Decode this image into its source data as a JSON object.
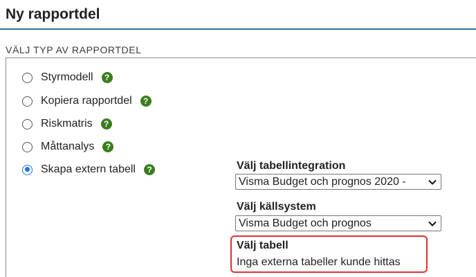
{
  "page": {
    "title": "Ny rapportdel",
    "section_label": "VÄLJ TYP AV RAPPORTDEL"
  },
  "options": [
    {
      "label": "Styrmodell",
      "selected": false,
      "help_icon": "question-circle-icon"
    },
    {
      "label": "Kopiera rapportdel",
      "selected": false,
      "help_icon": "question-circle-icon"
    },
    {
      "label": "Riskmatris",
      "selected": false,
      "help_icon": "question-circle-icon"
    },
    {
      "label": "Måttanalys",
      "selected": false,
      "help_icon": "question-circle-icon"
    },
    {
      "label": "Skapa extern tabell",
      "selected": true,
      "help_icon": "question-circle-icon"
    }
  ],
  "help_glyph": "?",
  "integration": {
    "label": "Välj tabellintegration",
    "selected": "Visma Budget och prognos 2020 -"
  },
  "source_system": {
    "label": "Välj källsystem",
    "selected": "Visma Budget och prognos"
  },
  "table": {
    "label": "Välj tabell",
    "empty_message": "Inga externa tabeller kunde hittas"
  },
  "colors": {
    "accent_rule": "#2a6f97",
    "radio_checked": "#1a73e8",
    "help_icon": "#3a7d1e",
    "highlight_border": "#e03131"
  }
}
